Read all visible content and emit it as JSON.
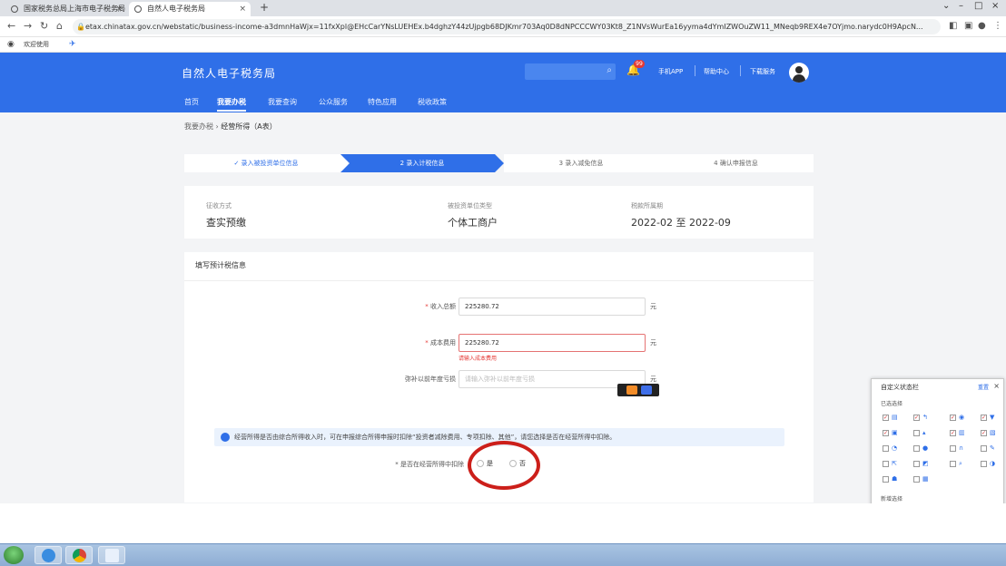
{
  "browser": {
    "tabs": [
      {
        "label": "国家税务总局上海市电子税务局",
        "active": false
      },
      {
        "label": "自然人电子税务局",
        "active": true
      }
    ],
    "url": "etax.chinatax.gov.cn/webstatic/business-income-a3dmnHaWjx=11fxXpl@EHcCarYNsLUEHEx.b4dghzY44zUjpgb68DJKmr703Aq0D8dNPCCCWY03Kt8_Z1NVsWurEa16yyma4dYmIZWOuZW11_MNeqb9REX4e7OYjmo.narydc0H9ApcN...",
    "bookmark": "欢迎使用"
  },
  "header": {
    "title": "自然人电子税务局",
    "notification_count": "99",
    "links": [
      "手机APP",
      "帮助中心",
      "下载服务"
    ],
    "nav": [
      "首页",
      "我要办税",
      "我要查询",
      "公众服务",
      "特色应用",
      "税收政策"
    ],
    "nav_active_index": 1,
    "accent_color": "#2f6fe8"
  },
  "breadcrumb": {
    "parent": "我要办税",
    "current": "经营所得（A表）"
  },
  "steps": [
    {
      "label": "✓ 录入被投资单位信息",
      "state": "done"
    },
    {
      "label": "2 录入计税信息",
      "state": "active"
    },
    {
      "label": "3 录入减免信息",
      "state": "pending"
    },
    {
      "label": "4 确认申报信息",
      "state": "pending"
    }
  ],
  "info": [
    {
      "label": "征收方式",
      "value": "查实预缴"
    },
    {
      "label": "被投资单位类型",
      "value": "个体工商户"
    },
    {
      "label": "税款所属期",
      "value": "2022-02 至 2022-09"
    }
  ],
  "form": {
    "heading": "填写预计税信息",
    "fields": [
      {
        "label": "收入总额",
        "value": "225280.72",
        "unit": "元",
        "placeholder": ""
      },
      {
        "label": "成本费用",
        "value": "225280.72",
        "unit": "元",
        "error": "请输入成本费用"
      },
      {
        "label": "弥补以前年度亏损",
        "value": "",
        "unit": "元",
        "placeholder": "请输入弥补以前年度亏损"
      }
    ],
    "notice": "经营所得是否由综合所得收入时，可在申报综合所得申报时扣除“投资者减除费用、专项扣除、其他”，请您选择是否在经营所得中扣除。",
    "radio_label": "* 是否在经营所得中扣除",
    "radio_options": [
      "是",
      "否"
    ]
  },
  "panel": {
    "title": "自定义状态栏",
    "reset": "重置",
    "section1": "已选选择",
    "section2": "新增选择"
  }
}
